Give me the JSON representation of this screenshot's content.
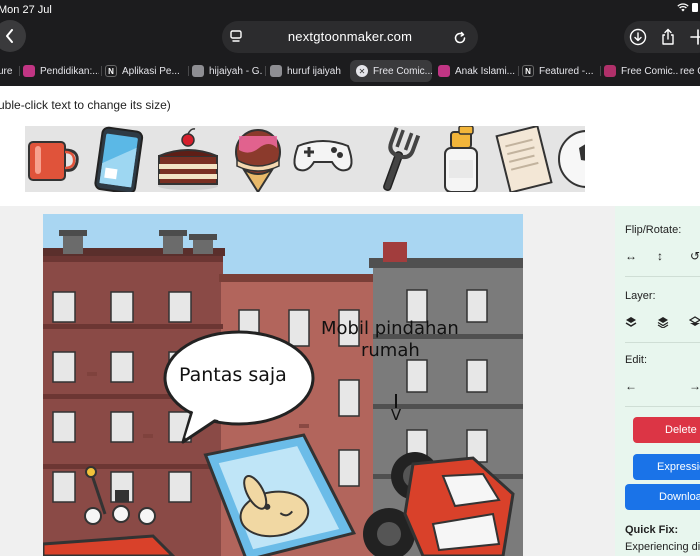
{
  "status_bar": {
    "time": "Mon 27 Jul"
  },
  "browser": {
    "url": "nextgtoonmaker.com",
    "tabs": [
      {
        "label": "ure",
        "favicon_color": "#555555",
        "favicon_letter": ""
      },
      {
        "label": "Pendidikan:...",
        "favicon_color": "#c13584",
        "favicon_letter": ""
      },
      {
        "label": "Aplikasi Pe...",
        "favicon_color": "#1c1c1e",
        "favicon_letter": "N"
      },
      {
        "label": "hijaiyah - G...",
        "favicon_color": "#8e8e93",
        "favicon_letter": ""
      },
      {
        "label": "huruf ijaiyah",
        "favicon_color": "#8e8e93",
        "favicon_letter": ""
      },
      {
        "label": "Free Comic...",
        "favicon_color": "#e5e5ea",
        "favicon_letter": ""
      },
      {
        "label": "Anak Islami...",
        "favicon_color": "#c13584",
        "favicon_letter": ""
      },
      {
        "label": "Featured -...",
        "favicon_color": "#1c1c1e",
        "favicon_letter": "N"
      },
      {
        "label": "Free Comic...",
        "favicon_color": "#b0306a",
        "favicon_letter": ""
      },
      {
        "label": "ree C",
        "favicon_color": "#1c1c1e",
        "favicon_letter": ""
      }
    ]
  },
  "page": {
    "hint": "uble-click text to change its size)"
  },
  "comic": {
    "speech_bubble": "Pantas saja",
    "caption_line1": "Mobil pindahan",
    "caption_line2": "rumah",
    "arrow_glyph": "V"
  },
  "sidebar": {
    "flip_rotate_label": "Flip/Rotate:",
    "layer_label": "Layer:",
    "edit_label": "Edit:",
    "delete_label": "Delete",
    "expression_label": "Expression",
    "download_label": "Download",
    "quick_fix_title": "Quick Fix:",
    "quick_fix_text": "Experiencing di"
  },
  "colors": {
    "chrome_bg": "#1c1c1e",
    "delete_btn": "#dc3545",
    "expression_btn": "#1a73e8",
    "download_btn": "#1a73e8",
    "sidebar_bg": "#e8f6ee",
    "sky": "#a9d6f2"
  }
}
